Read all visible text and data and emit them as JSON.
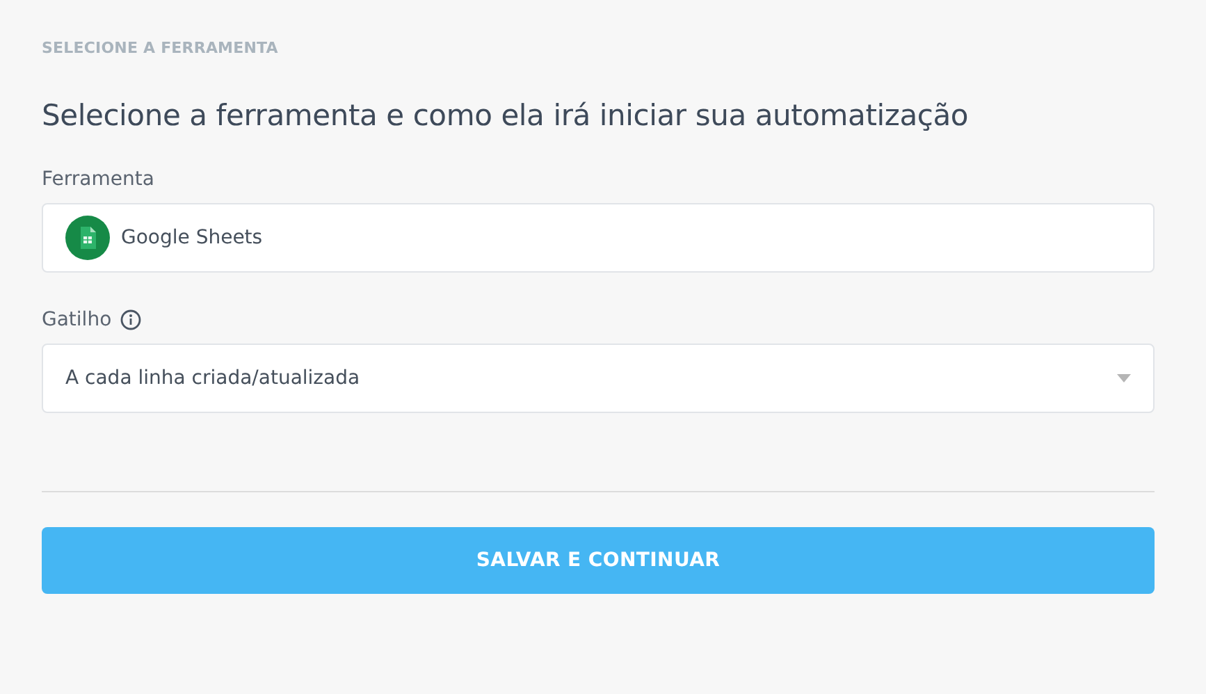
{
  "section_label": "SELECIONE A FERRAMENTA",
  "heading": "Selecione a ferramenta e como ela irá iniciar sua automatização",
  "tool_field": {
    "label": "Ferramenta",
    "value": "Google Sheets"
  },
  "trigger_field": {
    "label": "Gatilho",
    "value": "A cada linha criada/atualizada"
  },
  "submit_button": "SALVAR E CONTINUAR"
}
